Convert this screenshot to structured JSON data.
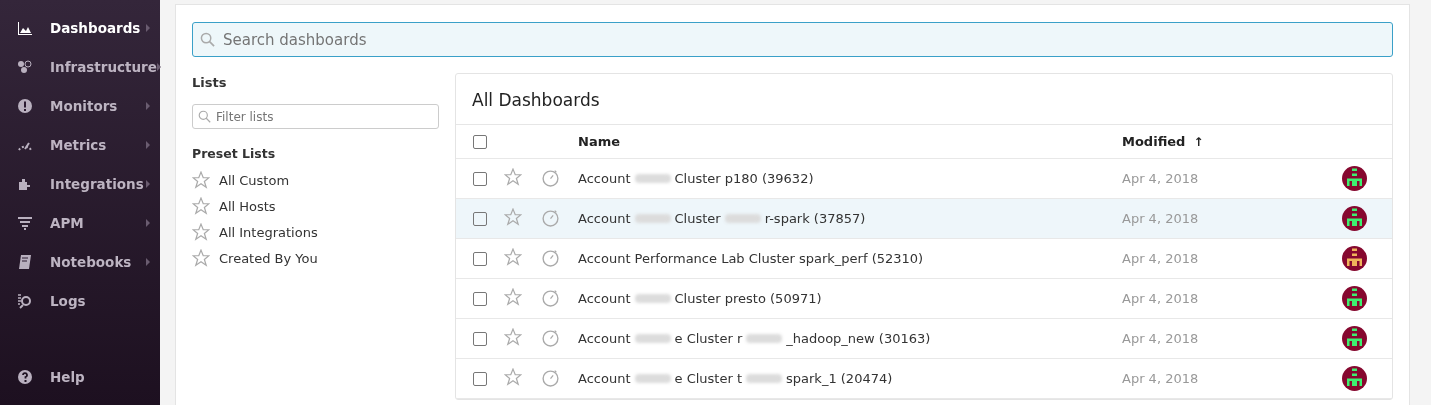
{
  "sidebar": {
    "items": [
      {
        "label": "Dashboards",
        "selected": true,
        "submenu": true
      },
      {
        "label": "Infrastructure",
        "selected": false,
        "submenu": true
      },
      {
        "label": "Monitors",
        "selected": false,
        "submenu": true
      },
      {
        "label": "Metrics",
        "selected": false,
        "submenu": true
      },
      {
        "label": "Integrations",
        "selected": false,
        "submenu": true
      },
      {
        "label": "APM",
        "selected": false,
        "submenu": true
      },
      {
        "label": "Notebooks",
        "selected": false,
        "submenu": true
      },
      {
        "label": "Logs",
        "selected": false,
        "submenu": false
      }
    ],
    "footer_items": [
      {
        "label": "Help"
      }
    ]
  },
  "search": {
    "placeholder": "Search dashboards"
  },
  "lists": {
    "title": "Lists",
    "filter_placeholder": "Filter lists",
    "preset_title": "Preset Lists",
    "presets": [
      "All Custom",
      "All Hosts",
      "All Integrations",
      "Created By You"
    ]
  },
  "table": {
    "title": "All Dashboards",
    "all_checked": false,
    "columns": [
      "Name",
      "Modified"
    ],
    "sort_indicator": "↑",
    "rows": [
      {
        "name": [
          {
            "kind": "text",
            "text": "Account"
          },
          {
            "kind": "redacted"
          },
          {
            "kind": "text",
            "text": "Cluster p180 (39632)"
          }
        ],
        "modified": "Apr 4, 2018",
        "highlighted": false,
        "checked": false,
        "starred": false,
        "color": "#3ef070"
      },
      {
        "name": [
          {
            "kind": "text",
            "text": "Account"
          },
          {
            "kind": "redacted"
          },
          {
            "kind": "text",
            "text": "Cluster"
          },
          {
            "kind": "redacted"
          },
          {
            "kind": "text",
            "text": "r-spark (37857)"
          }
        ],
        "modified": "Apr 4, 2018",
        "highlighted": true,
        "checked": false,
        "starred": false,
        "color": "#3ef070"
      },
      {
        "name": [
          {
            "kind": "text",
            "text": "Account Performance Lab Cluster spark_perf (52310)"
          }
        ],
        "modified": "Apr 4, 2018",
        "highlighted": false,
        "checked": false,
        "starred": false,
        "color": "#f0b45a"
      },
      {
        "name": [
          {
            "kind": "text",
            "text": "Account"
          },
          {
            "kind": "redacted"
          },
          {
            "kind": "text",
            "text": "Cluster presto (50971)"
          }
        ],
        "modified": "Apr 4, 2018",
        "highlighted": false,
        "checked": false,
        "starred": false,
        "color": "#3ef070"
      },
      {
        "name": [
          {
            "kind": "text",
            "text": "Account"
          },
          {
            "kind": "redacted"
          },
          {
            "kind": "text",
            "text": "e Cluster r"
          },
          {
            "kind": "redacted"
          },
          {
            "kind": "text",
            "text": "_hadoop_new (30163)"
          }
        ],
        "modified": "Apr 4, 2018",
        "highlighted": false,
        "checked": false,
        "starred": false,
        "color": "#3ef070"
      },
      {
        "name": [
          {
            "kind": "text",
            "text": "Account"
          },
          {
            "kind": "redacted"
          },
          {
            "kind": "text",
            "text": "e Cluster t"
          },
          {
            "kind": "redacted"
          },
          {
            "kind": "text",
            "text": "spark_1 (20474)"
          }
        ],
        "modified": "Apr 4, 2018",
        "highlighted": false,
        "checked": false,
        "starred": false,
        "color": "#3ef070"
      }
    ]
  }
}
